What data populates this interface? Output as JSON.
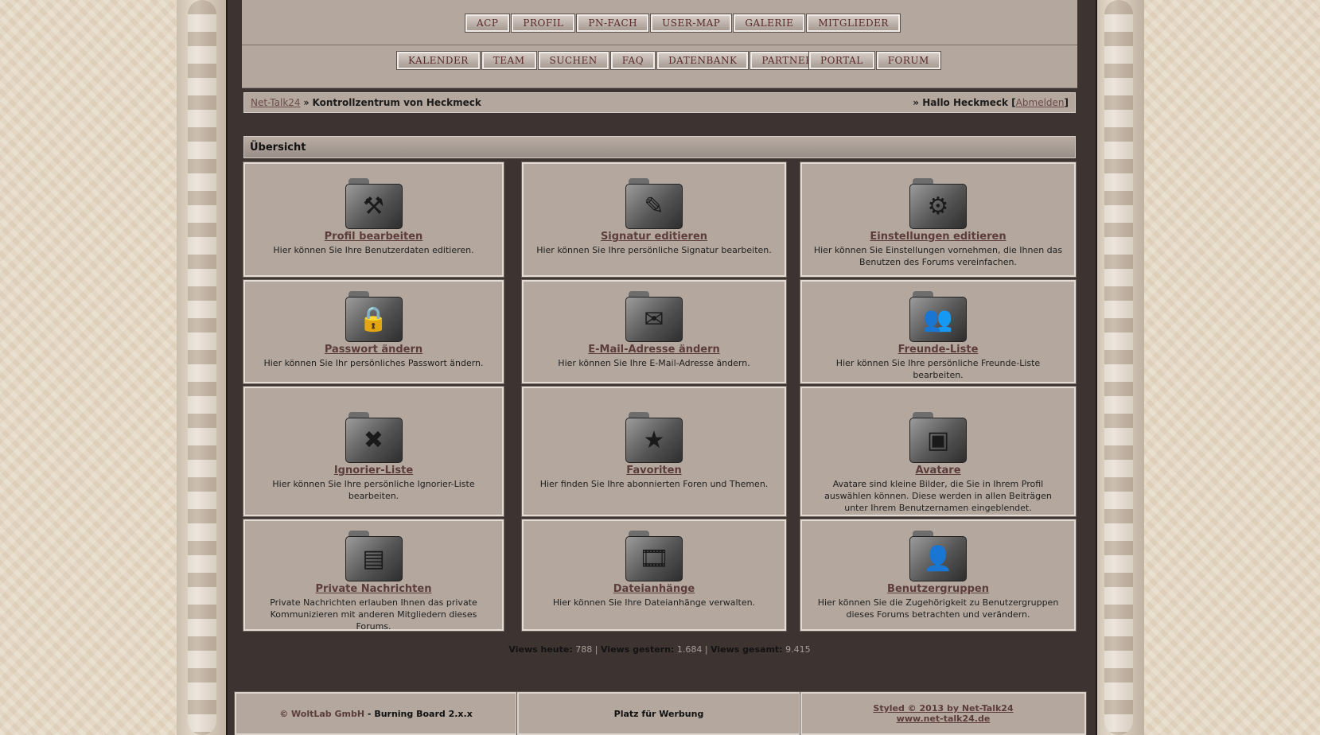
{
  "nav": {
    "row1": [
      "ACP",
      "PROFIL",
      "PN-FACH",
      "USER-MAP",
      "GALERIE",
      "MITGLIEDER"
    ],
    "row2": [
      "KALENDER",
      "TEAM",
      "SUCHEN",
      "FAQ",
      "DATENBANK",
      "PARTNER"
    ],
    "row3": [
      "PORTAL",
      "FORUM"
    ]
  },
  "breadcrumb": {
    "home": "Net-Talk24",
    "separator": " » ",
    "current": "Kontrollzentrum von Heckmeck",
    "greeting_prefix": "» ",
    "greeting": "Hallo Heckmeck",
    "logout_open": " [",
    "logout": "Abmelden",
    "logout_close": "]"
  },
  "section": {
    "title": "Übersicht"
  },
  "cells": [
    {
      "icon": "hammer-folder-icon",
      "glyph": "⚒",
      "title": "Profil bearbeiten",
      "desc": "Hier können Sie Ihre Benutzerdaten editieren."
    },
    {
      "icon": "pencil-folder-icon",
      "glyph": "✎",
      "title": "Signatur editieren",
      "desc": "Hier können Sie Ihre persönliche Signatur bearbeiten."
    },
    {
      "icon": "gear-folder-icon",
      "glyph": "⚙",
      "title": "Einstellungen editieren",
      "desc": "Hier können Sie Einstellungen vornehmen, die Ihnen das Benutzen des Forums vereinfachen."
    },
    {
      "icon": "lock-folder-icon",
      "glyph": "🔒",
      "title": "Passwort ändern",
      "desc": "Hier können Sie Ihr persönliches Passwort ändern."
    },
    {
      "icon": "envelope-folder-icon",
      "glyph": "✉",
      "title": "E-Mail-Adresse ändern",
      "desc": "Hier können Sie Ihre E-Mail-Adresse ändern."
    },
    {
      "icon": "group-folder-icon",
      "glyph": "👥",
      "title": "Freunde-Liste",
      "desc": "Hier können Sie Ihre persönliche Freunde-Liste bearbeiten."
    },
    {
      "icon": "x-folder-icon",
      "glyph": "✖",
      "title": "Ignorier-Liste",
      "desc": "Hier können Sie Ihre persönliche Ignorier-Liste bearbeiten."
    },
    {
      "icon": "star-folder-icon",
      "glyph": "★",
      "title": "Favoriten",
      "desc": "Hier finden Sie Ihre abonnierten Foren und Themen."
    },
    {
      "icon": "picture-folder-icon",
      "glyph": "▣",
      "title": "Avatare",
      "desc": "Avatare sind kleine Bilder, die Sie in Ihrem Profil auswählen können. Diese werden in allen Beiträgen unter Ihrem Benutzernamen eingeblendet."
    },
    {
      "icon": "document-folder-icon",
      "glyph": "▤",
      "title": "Private Nachrichten",
      "desc": "Private Nachrichten erlauben Ihnen das private Kommunizieren mit anderen Mitgliedern dieses Forums."
    },
    {
      "icon": "film-folder-icon",
      "glyph": "🎞",
      "title": "Dateianhänge",
      "desc": "Hier können Sie Ihre Dateianhänge verwalten."
    },
    {
      "icon": "user-folder-icon",
      "glyph": "👤",
      "title": "Benutzergruppen",
      "desc": "Hier können Sie die Zugehörigkeit zu Benutzergruppen dieses Forums betrachten und verändern."
    }
  ],
  "stats": {
    "today_label": "Views heute:",
    "today": "788",
    "yesterday_label": "Views gestern:",
    "yesterday": "1.684",
    "total_label": "Views gesamt:",
    "total": "9.415",
    "sep": "|"
  },
  "footer": {
    "copyright": "© WoltLab GmbH",
    "dash": " - ",
    "product": "Burning Board 2.x.x",
    "ad": "Platz für Werbung",
    "styled": "Styled © 2013 by Net-Talk24",
    "site": "www.net-talk24.de"
  }
}
